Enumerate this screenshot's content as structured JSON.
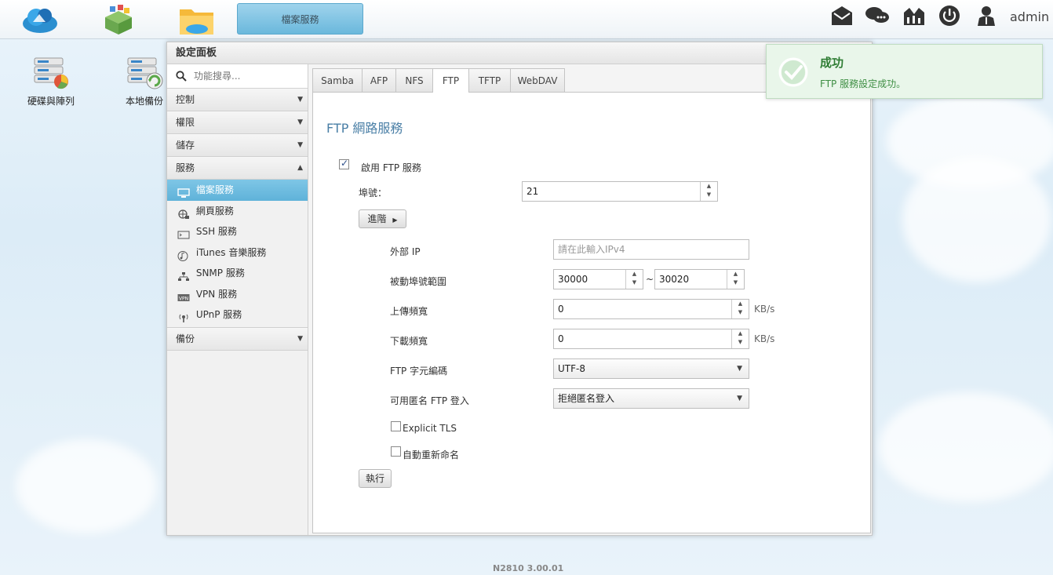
{
  "topbar": {
    "active_task": "檔案服務",
    "user": "admin",
    "icons": [
      "cloud-app-icon",
      "package-app-icon",
      "folder-app-icon",
      "mail-icon",
      "chat-icon",
      "monitor-icon",
      "power-icon",
      "user-icon"
    ]
  },
  "desktop": {
    "icons": [
      {
        "label": "硬碟與陣列",
        "icon": "disk-array-icon"
      },
      {
        "label": "本地備份",
        "icon": "local-backup-icon"
      }
    ]
  },
  "panel": {
    "title": "設定面板",
    "search_placeholder": "功能搜尋...",
    "categories": [
      {
        "label": "控制",
        "arrow": "▼"
      },
      {
        "label": "權限",
        "arrow": "▼"
      },
      {
        "label": "儲存",
        "arrow": "▼"
      },
      {
        "label": "服務",
        "arrow": "▲"
      },
      {
        "label": "備份",
        "arrow": "▼"
      }
    ],
    "service_items": [
      {
        "label": "檔案服務",
        "icon": "file-service-icon"
      },
      {
        "label": "網頁服務",
        "icon": "web-service-icon"
      },
      {
        "label": "SSH 服務",
        "icon": "ssh-icon"
      },
      {
        "label": "iTunes 音樂服務",
        "icon": "music-icon"
      },
      {
        "label": "SNMP 服務",
        "icon": "network-tree-icon"
      },
      {
        "label": "VPN 服務",
        "icon": "vpn-icon"
      },
      {
        "label": "UPnP 服務",
        "icon": "antenna-icon"
      }
    ]
  },
  "tabs": [
    "Samba",
    "AFP",
    "NFS",
    "FTP",
    "TFTP",
    "WebDAV"
  ],
  "active_tab": "FTP",
  "form": {
    "section_title": "FTP 網路服務",
    "enable_label": "啟用 FTP 服務",
    "enable_checked": true,
    "port_label": "埠號：",
    "port_value": "21",
    "advanced_label": "進階",
    "external_ip_label": "外部 IP",
    "external_ip_placeholder": "請在此輸入IPv4",
    "passive_range_label": "被動埠號範圍",
    "passive_from": "30000",
    "range_sep": "~",
    "passive_to": "30020",
    "upload_label": "上傳頻寬",
    "upload_value": "0",
    "download_label": "下載頻寬",
    "download_value": "0",
    "unit": "KB/s",
    "encoding_label": "FTP 字元編碼",
    "encoding_value": "UTF-8",
    "anon_label": "可用匿名 FTP 登入",
    "anon_value": "拒絕匿名登入",
    "explicit_tls_label": "Explicit TLS",
    "explicit_tls_checked": false,
    "auto_rename_label": "自動重新命名",
    "auto_rename_checked": false,
    "apply_label": "執行"
  },
  "toast": {
    "title": "成功",
    "message": "FTP 服務設定成功。"
  },
  "footer": {
    "version": "N2810   3.00.01"
  }
}
